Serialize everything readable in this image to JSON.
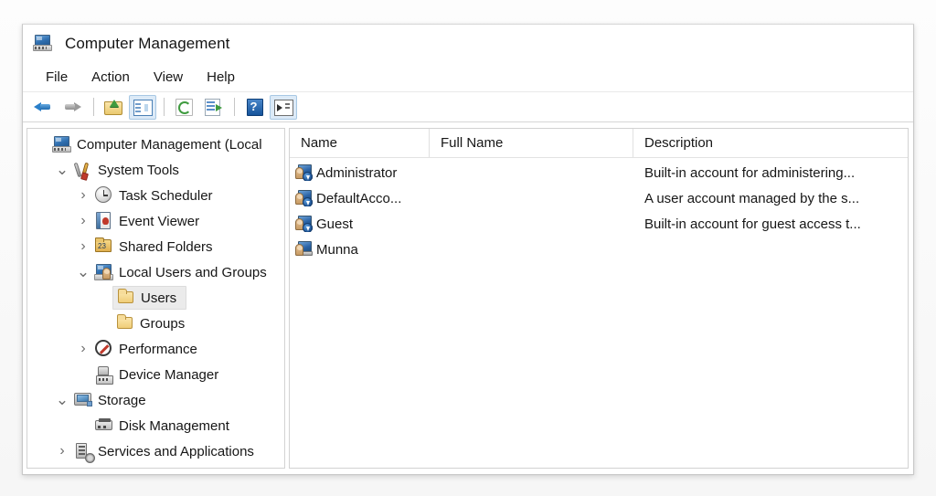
{
  "window": {
    "title": "Computer Management",
    "icon": "computer-management-icon"
  },
  "menubar": {
    "items": [
      {
        "label": "File",
        "name": "menu-file"
      },
      {
        "label": "Action",
        "name": "menu-action"
      },
      {
        "label": "View",
        "name": "menu-view"
      },
      {
        "label": "Help",
        "name": "menu-help"
      }
    ]
  },
  "toolbar": {
    "buttons": [
      {
        "name": "back-button",
        "icon": "back-arrow-icon",
        "active": false
      },
      {
        "name": "forward-button",
        "icon": "forward-arrow-icon",
        "active": false
      },
      {
        "name": "up-one-level-button",
        "icon": "up-folder-icon",
        "active": false
      },
      {
        "name": "show-hide-console-tree-button",
        "icon": "console-tree-icon",
        "active": true
      },
      {
        "name": "refresh-button",
        "icon": "refresh-icon",
        "active": false
      },
      {
        "name": "export-list-button",
        "icon": "export-list-icon",
        "active": false
      },
      {
        "name": "help-button",
        "icon": "help-icon",
        "active": false
      },
      {
        "name": "show-hide-action-pane-button",
        "icon": "action-pane-icon",
        "active": true
      }
    ]
  },
  "tree": {
    "items": [
      {
        "label": "Computer Management (Local",
        "icon": "computer-icon",
        "indent": 0,
        "chevron": "none",
        "selected": false,
        "name": "tree-item-computer-management"
      },
      {
        "label": "System Tools",
        "icon": "system-tools-icon",
        "indent": 1,
        "chevron": "expanded",
        "selected": false,
        "name": "tree-item-system-tools"
      },
      {
        "label": "Task Scheduler",
        "icon": "clock-icon",
        "indent": 2,
        "chevron": "collapsed",
        "selected": false,
        "name": "tree-item-task-scheduler"
      },
      {
        "label": "Event Viewer",
        "icon": "event-log-icon",
        "indent": 2,
        "chevron": "collapsed",
        "selected": false,
        "name": "tree-item-event-viewer"
      },
      {
        "label": "Shared Folders",
        "icon": "shared-folders-icon",
        "indent": 2,
        "chevron": "collapsed",
        "selected": false,
        "name": "tree-item-shared-folders"
      },
      {
        "label": "Local Users and Groups",
        "icon": "local-users-icon",
        "indent": 2,
        "chevron": "expanded",
        "selected": false,
        "name": "tree-item-local-users-and-groups"
      },
      {
        "label": "Users",
        "icon": "folder-icon",
        "indent": 3,
        "chevron": "none",
        "selected": true,
        "name": "tree-item-users"
      },
      {
        "label": "Groups",
        "icon": "folder-icon",
        "indent": 3,
        "chevron": "none",
        "selected": false,
        "name": "tree-item-groups"
      },
      {
        "label": "Performance",
        "icon": "performance-icon",
        "indent": 2,
        "chevron": "collapsed",
        "selected": false,
        "name": "tree-item-performance"
      },
      {
        "label": "Device Manager",
        "icon": "device-manager-icon",
        "indent": 2,
        "chevron": "none",
        "selected": false,
        "name": "tree-item-device-manager"
      },
      {
        "label": "Storage",
        "icon": "storage-icon",
        "indent": 1,
        "chevron": "expanded",
        "selected": false,
        "name": "tree-item-storage"
      },
      {
        "label": "Disk Management",
        "icon": "disk-management-icon",
        "indent": 2,
        "chevron": "none",
        "selected": false,
        "name": "tree-item-disk-management"
      },
      {
        "label": "Services and Applications",
        "icon": "services-icon",
        "indent": 1,
        "chevron": "collapsed",
        "selected": false,
        "name": "tree-item-services-and-applications"
      }
    ]
  },
  "list": {
    "columns": [
      {
        "label": "Name",
        "name": "column-header-name"
      },
      {
        "label": "Full Name",
        "name": "column-header-full-name"
      },
      {
        "label": "Description",
        "name": "column-header-description"
      }
    ],
    "rows": [
      {
        "name": "Administrator",
        "full_name": "",
        "description": "Built-in account for administering...",
        "icon": "user-disabled-icon"
      },
      {
        "name": "DefaultAcco...",
        "full_name": "",
        "description": "A user account managed by the s...",
        "icon": "user-disabled-icon"
      },
      {
        "name": "Guest",
        "full_name": "",
        "description": "Built-in account for guest access t...",
        "icon": "user-disabled-icon"
      },
      {
        "name": "Munna",
        "full_name": "",
        "description": "",
        "icon": "user-icon"
      }
    ]
  },
  "colors": {
    "accent_blue": "#2a7fc9",
    "toolbar_active_bg": "#dceaf7",
    "toolbar_active_border": "#a8c8e4",
    "selection_bg": "#ebebeb",
    "text": "#161616",
    "pane_border": "#d2d2d2"
  }
}
